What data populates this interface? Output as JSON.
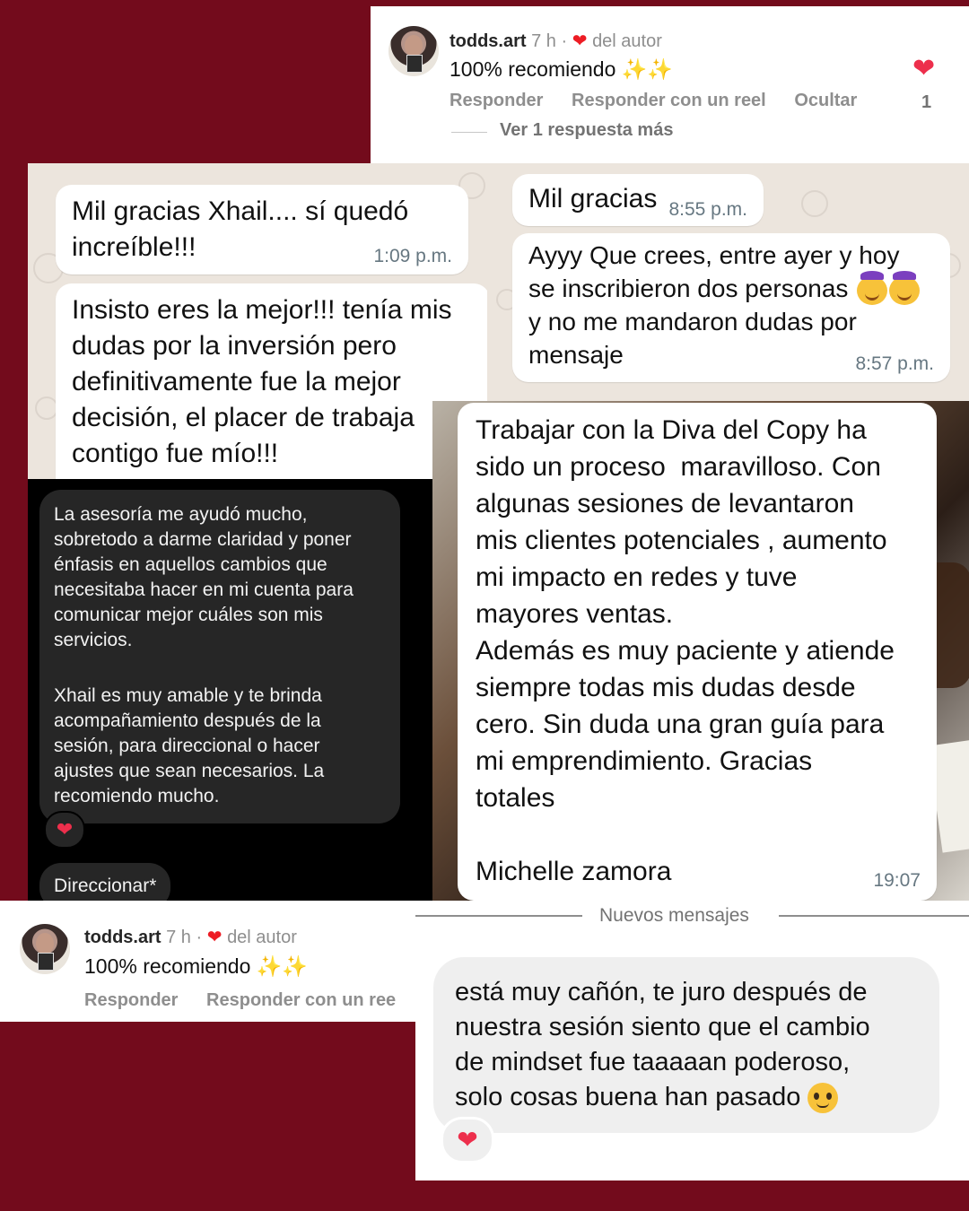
{
  "background_color": "#730b1c",
  "top_comment": {
    "username": "todds.art",
    "time": "7 h",
    "separator": "·",
    "author_badge": "del autor",
    "text": "100% recomiendo",
    "sparkles": "✨✨",
    "actions": [
      "Responder",
      "Responder con un reel",
      "Ocultar"
    ],
    "like_count": "1",
    "view_replies": "Ver 1 respuesta más"
  },
  "whatsapp_left": {
    "messages": [
      {
        "text_lines": [
          "Mil gracias Xhail.... sí quedó",
          "increíble!!!"
        ],
        "time": "1:09 p.m."
      },
      {
        "text_lines": [
          "Insisto eres la mejor!!! tenía mis",
          "dudas por la inversión pero",
          "definitivamente fue la mejor",
          "decisión, el placer de trabaja",
          "contigo fue mío!!!"
        ]
      }
    ]
  },
  "whatsapp_right": {
    "messages": [
      {
        "text": "Mil gracias",
        "time": "8:55 p.m."
      },
      {
        "text_lines": [
          "Ayyy Que crees, entre ayer y hoy",
          "se inscribieron dos personas",
          "y no me mandaron dudas por",
          "mensaje"
        ],
        "time": "8:57 p.m."
      }
    ]
  },
  "dark_chat": {
    "paragraph_1": [
      "La asesoría me ayudó mucho,",
      "sobretodo a darme claridad y poner",
      "énfasis en aquellos cambios que",
      "necesitaba hacer en mi cuenta para",
      "comunicar mejor cuáles son mis",
      "servicios."
    ],
    "paragraph_2": [
      "Xhail es muy amable y te brinda",
      "acompañamiento después de la",
      "sesión, para direccional o hacer",
      "ajustes que sean necesarios. La",
      "recomiendo mucho."
    ],
    "reaction": "❤",
    "chip": "Direccionar*"
  },
  "testimonial": {
    "lines": [
      "Trabajar con la Diva del Copy ha",
      "sido un proceso  maravilloso. Con",
      "algunas sesiones de levantaron",
      "mis clientes potenciales , aumento",
      "mi impacto en redes y tuve",
      "mayores ventas.",
      "Además es muy paciente y atiende",
      "siempre todas mis dudas desde",
      "cero. Sin duda una gran guía para",
      "mi emprendimiento. Gracias",
      "totales"
    ],
    "signature": "Michelle zamora",
    "time": "19:07"
  },
  "bottom_comment": {
    "username": "todds.art",
    "time": "7 h",
    "separator": "·",
    "author_badge": "del autor",
    "text": "100% recomiendo",
    "sparkles": "✨✨",
    "actions": [
      "Responder",
      "Responder con un ree"
    ]
  },
  "new_messages": {
    "divider": "Nuevos mensajes",
    "lines": [
      "está muy cañón, te juro después de",
      "nuestra sesión siento que el cambio",
      "de mindset fue taaaaan poderoso,",
      "solo cosas buena han pasado"
    ],
    "reaction": "❤"
  }
}
